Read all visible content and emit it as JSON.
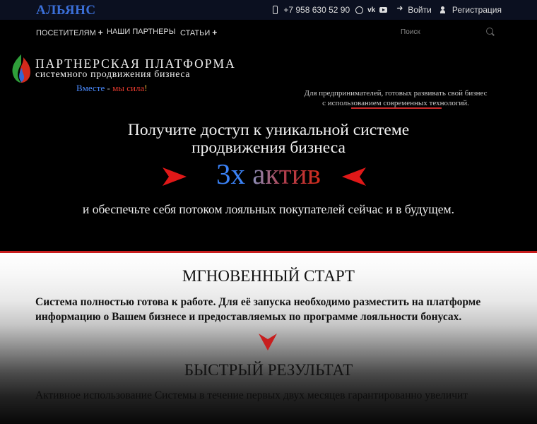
{
  "topbar": {
    "brand": "АЛЬЯНС",
    "phone": "+7 958 630 52 90",
    "social_icons": [
      "whatsapp-icon",
      "vk-icon",
      "youtube-icon"
    ],
    "vk_glyph": "vk",
    "login_label": "Войти",
    "register_label": "Регистрация"
  },
  "nav": {
    "items": [
      {
        "label": "ПОСЕТИТЕЛЯМ",
        "has_submenu": true,
        "submenu_glyph": "+"
      },
      {
        "label": "НАШИ ПАРТНЕРЫ",
        "has_submenu": false
      },
      {
        "label": "СТАТЬИ",
        "has_submenu": true,
        "submenu_glyph": "+"
      }
    ],
    "search_placeholder": "Поиск"
  },
  "hero": {
    "platform_title": "ПАРТНЕРСКАЯ ПЛАТФОРМА",
    "platform_subtitle": "системного продвижения бизнеса",
    "slogan": {
      "part1": "Вместе",
      "part2": " - ",
      "part3": "мы сила",
      "part4": "!"
    },
    "entrepreneurs_line1": "Для предпринимателей, готовых развивать свой бизнес",
    "entrepreneurs_line2": "с использованием современных технологий.",
    "headline_line1": "Получите доступ к уникальной системе",
    "headline_line2": "продвижения бизнеса",
    "brand_part1": "3х",
    "brand_part2": "актив",
    "subline": "и обеспечьте себя потоком лояльных покупателей сейчас и в будущем."
  },
  "instant": {
    "title": "МГНОВЕННЫЙ СТАРТ",
    "text": "Система полностью готова к работе. Для её запуска необходимо разместить на платформе информацию о Вашем бизнесе и предоставляемых по программе лояльности бонусах."
  },
  "fast": {
    "title": "БЫСТРЫЙ РЕЗУЛЬТАТ",
    "text": "Активное использование Системы в течение первых двух месяцев гарантированно увеличит"
  },
  "colors": {
    "accent_red": "#c81e1e",
    "brand_blue": "#3b82f6",
    "topbar_bg": "#0b1020"
  }
}
